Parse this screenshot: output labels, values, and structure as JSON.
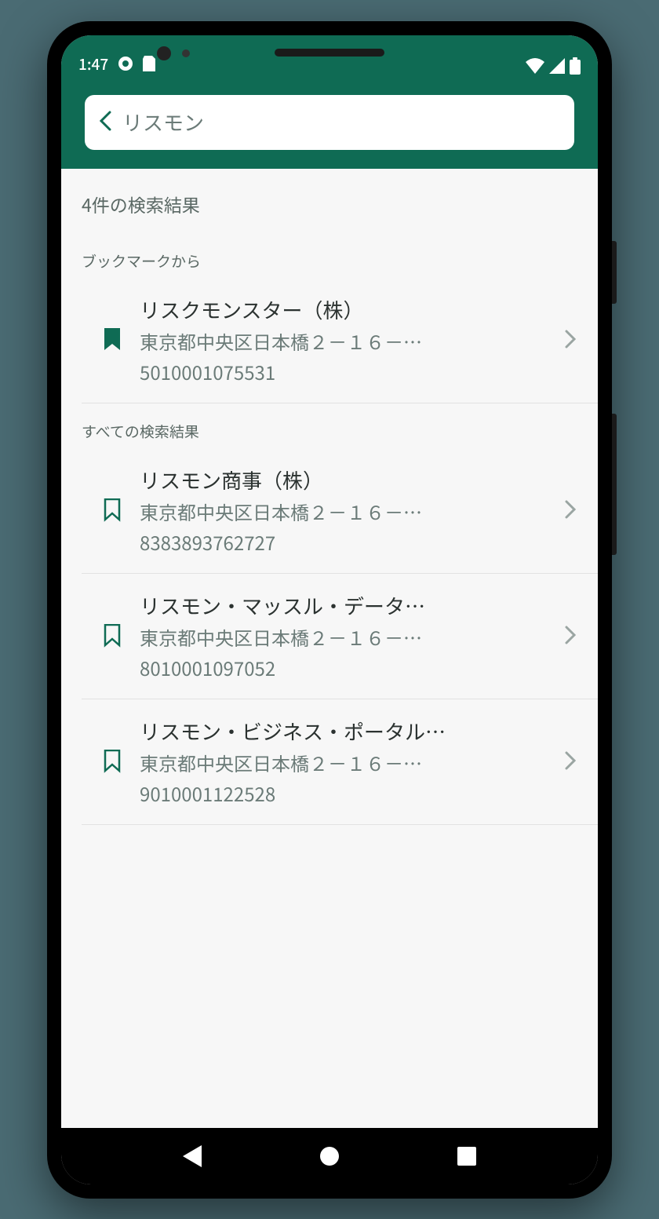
{
  "status": {
    "time": "1:47"
  },
  "search": {
    "value": "リスモン"
  },
  "results": {
    "count_label": "4件の検索結果",
    "bookmark_section_label": "ブックマークから",
    "all_section_label": "すべての検索結果",
    "bookmarked": [
      {
        "title": "リスクモンスター（株）",
        "address": "東京都中央区日本橋２－１６－…",
        "id": "5010001075531",
        "bookmarked": true
      }
    ],
    "all": [
      {
        "title": "リスモン商事（株）",
        "address": "東京都中央区日本橋２－１６－…",
        "id": "8383893762727",
        "bookmarked": false
      },
      {
        "title": "リスモン・マッスル・データ…",
        "address": "東京都中央区日本橋２－１６－…",
        "id": "8010001097052",
        "bookmarked": false
      },
      {
        "title": "リスモン・ビジネス・ポータル…",
        "address": "東京都中央区日本橋２－１６－…",
        "id": "9010001122528",
        "bookmarked": false
      }
    ]
  },
  "colors": {
    "primary": "#0f6b54",
    "background": "#f7f7f7"
  }
}
